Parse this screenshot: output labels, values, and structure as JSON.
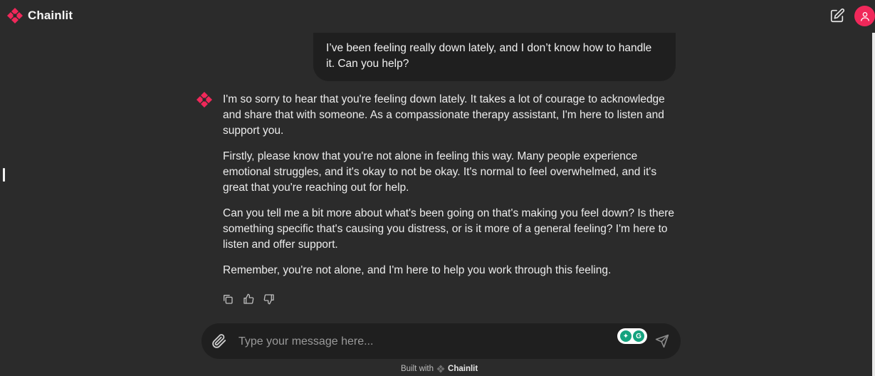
{
  "app": {
    "name": "Chainlit",
    "accent_color": "#f0285a"
  },
  "header": {
    "new_chat_icon": "pencil-square-icon",
    "avatar_icon": "user-icon"
  },
  "user_message": {
    "text": "I’ve been feeling really down lately, and I don’t know how to handle it. Can you help?"
  },
  "assistant_message": {
    "paragraphs": [
      "I'm so sorry to hear that you're feeling down lately. It takes a lot of courage to acknowledge and share that with someone. As a compassionate therapy assistant, I'm here to listen and support you.",
      "Firstly, please know that you're not alone in feeling this way. Many people experience emotional struggles, and it's okay to not be okay. It's normal to feel overwhelmed, and it's great that you're reaching out for help.",
      "Can you tell me a bit more about what's been going on that's making you feel down? Is there something specific that's causing you distress, or is it more of a general feeling? I'm here to listen and offer support.",
      "Remember, you're not alone, and I'm here to help you work through this feeling."
    ],
    "actions": [
      "copy-icon",
      "thumbs-up-icon",
      "thumbs-down-icon"
    ]
  },
  "composer": {
    "placeholder": "Type your message here...",
    "value": ""
  },
  "footer": {
    "prefix": "Built with",
    "brand": "Chainlit"
  }
}
